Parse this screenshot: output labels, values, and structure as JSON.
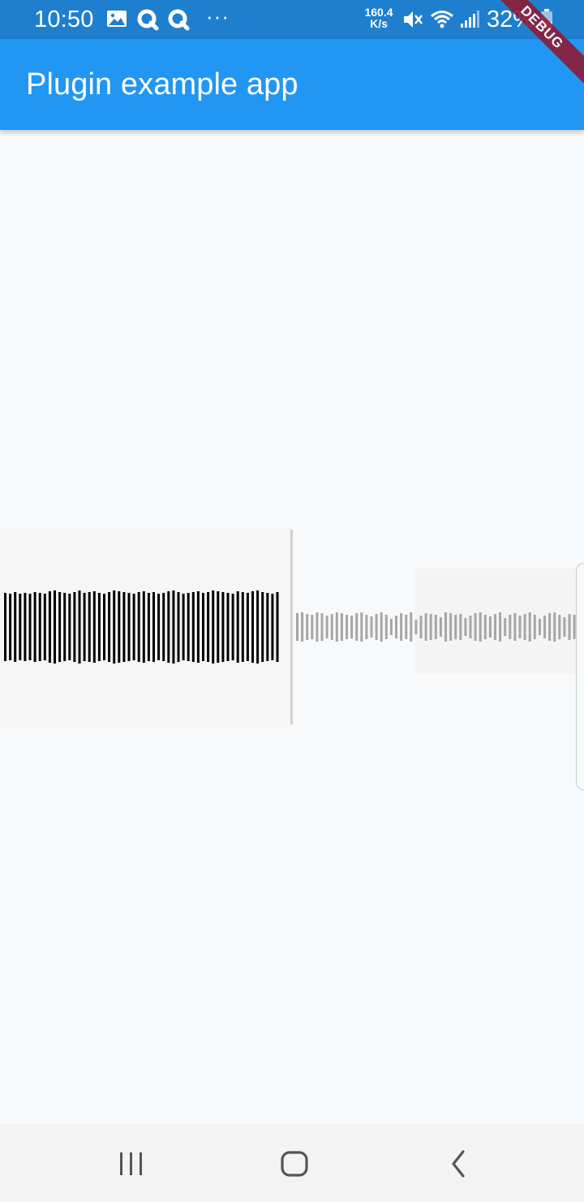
{
  "status_bar": {
    "time": "10:50",
    "more_indicator": "···",
    "network_speed_value": "160.4",
    "network_speed_unit": "K/s",
    "battery_percent": "32%",
    "icons": [
      "image-icon",
      "q-app-icon",
      "q-app-icon",
      "mute-icon",
      "wifi-icon",
      "signal-icon",
      "battery-icon"
    ]
  },
  "app_bar": {
    "title": "Plugin example app"
  },
  "debug_banner": {
    "label": "DEBUG"
  },
  "waveform": {
    "played_color": "#000000",
    "unplayed_color": "#a6a6a6",
    "cursor_color": "#d0d0d0",
    "playback_position": 0.5
  },
  "nav_bar": {
    "icons": [
      "recent-apps-icon",
      "home-icon",
      "back-icon"
    ]
  },
  "colors": {
    "status_bar": "#1f7fcf",
    "app_bar": "#2196f3",
    "background": "#f8f9fb",
    "debug_banner": "#8b1e3a"
  }
}
